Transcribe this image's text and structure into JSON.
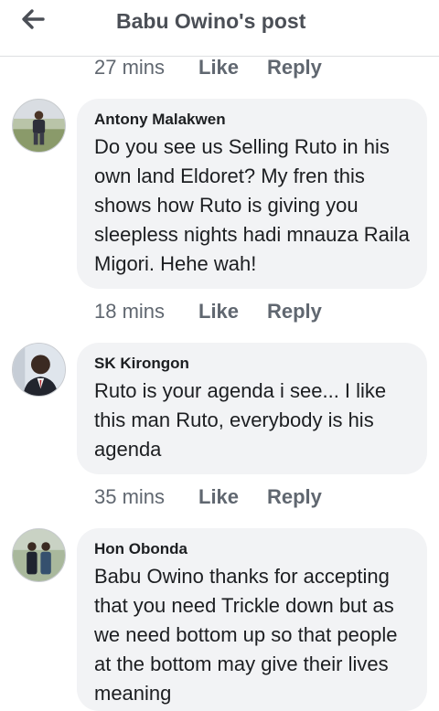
{
  "header": {
    "title": "Babu Owino's post",
    "back_icon": "arrow-left-icon"
  },
  "actions": {
    "like_label": "Like",
    "reply_label": "Reply"
  },
  "top_meta": {
    "time": "27 mins"
  },
  "comments": [
    {
      "author": "Antony Malakwen",
      "text": "Do you see us Selling Ruto in his own land Eldoret? My fren this shows how Ruto is giving you sleepless nights hadi mnauza Raila Migori. Hehe wah!",
      "time": "18 mins"
    },
    {
      "author": "SK Kirongon",
      "text": "Ruto is your agenda i see... I like this man Ruto, everybody is his agenda",
      "time": "35 mins"
    },
    {
      "author": "Hon Obonda",
      "text": "Babu Owino thanks for accepting that you need Trickle down but as we need bottom up so that people at the bottom may give their lives meaning",
      "time": ""
    }
  ],
  "colors": {
    "bubble": "#f2f3f5",
    "meta_text": "#606770",
    "title_text": "#4b4f56"
  }
}
